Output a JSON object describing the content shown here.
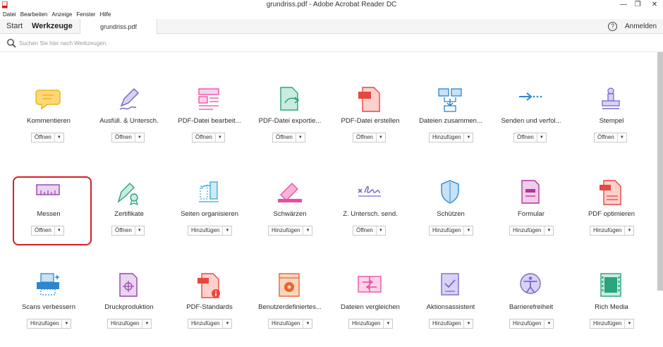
{
  "window": {
    "title": "grundriss.pdf - Adobe Acrobat Reader DC",
    "minimize": "—",
    "maximize": "❐",
    "close": "✕"
  },
  "menu": [
    "Datei",
    "Bearbeiten",
    "Anzeige",
    "Fenster",
    "Hilfe"
  ],
  "tabs": {
    "start": "Start",
    "tools": "Werkzeuge",
    "document": "grundriss.pdf"
  },
  "header": {
    "help": "?",
    "login": "Anmelden"
  },
  "search": {
    "placeholder": "Suchen Sie hier nach Werkzeugen."
  },
  "tools": [
    {
      "label": "Kommentieren",
      "button": "Öffnen",
      "icon": "comment-icon",
      "color": "#f2b21a"
    },
    {
      "label": "Ausfüll. & Untersch.",
      "button": "Öffnen",
      "icon": "fill-sign-icon",
      "color": "#7b68c9"
    },
    {
      "label": "PDF-Datei bearbeit...",
      "button": "Öffnen",
      "icon": "edit-pdf-icon",
      "color": "#e94ba0"
    },
    {
      "label": "PDF-Datei exportie...",
      "button": "Öffnen",
      "icon": "export-pdf-icon",
      "color": "#2aa37f"
    },
    {
      "label": "PDF-Datei erstellen",
      "button": "Öffnen",
      "icon": "create-pdf-icon",
      "color": "#e8473e"
    },
    {
      "label": "Dateien zusammen...",
      "button": "Hinzufügen",
      "icon": "combine-files-icon",
      "color": "#2c87d0"
    },
    {
      "label": "Senden und verfol...",
      "button": "Öffnen",
      "icon": "send-track-icon",
      "color": "#2c87d0"
    },
    {
      "label": "Stempel",
      "button": "Öffnen",
      "icon": "stamp-icon",
      "color": "#7b68c9"
    },
    {
      "label": "Messen",
      "button": "Öffnen",
      "icon": "measure-icon",
      "color": "#9a3fb0"
    },
    {
      "label": "Zertifikate",
      "button": "Öffnen",
      "icon": "certificates-icon",
      "color": "#2aa37f"
    },
    {
      "label": "Seiten organisieren",
      "button": "Hinzufügen",
      "icon": "organize-pages-icon",
      "color": "#3aa6d0"
    },
    {
      "label": "Schwärzen",
      "button": "Hinzufügen",
      "icon": "redact-icon",
      "color": "#e94ba0"
    },
    {
      "label": "Z. Untersch. send.",
      "button": "Öffnen",
      "icon": "send-signature-icon",
      "color": "#7b68c9"
    },
    {
      "label": "Schützen",
      "button": "Hinzufügen",
      "icon": "protect-icon",
      "color": "#2c87d0"
    },
    {
      "label": "Formular",
      "button": "Hinzufügen",
      "icon": "form-icon",
      "color": "#b0369c"
    },
    {
      "label": "PDF optimieren",
      "button": "Hinzufügen",
      "icon": "optimize-pdf-icon",
      "color": "#e8473e"
    },
    {
      "label": "Scans verbessern",
      "button": "Hinzufügen",
      "icon": "enhance-scans-icon",
      "color": "#2c87d0"
    },
    {
      "label": "Druckproduktion",
      "button": "Hinzufügen",
      "icon": "print-production-icon",
      "color": "#9a3fb0"
    },
    {
      "label": "PDF-Standards",
      "button": "Hinzufügen",
      "icon": "pdf-standards-icon",
      "color": "#e8473e"
    },
    {
      "label": "Benutzerdefiniertes...",
      "button": "Hinzufügen",
      "icon": "custom-tool-icon",
      "color": "#e8652a"
    },
    {
      "label": "Dateien vergleichen",
      "button": "Hinzufügen",
      "icon": "compare-files-icon",
      "color": "#e94ba0"
    },
    {
      "label": "Aktionsassistent",
      "button": "Hinzufügen",
      "icon": "action-wizard-icon",
      "color": "#7b68c9"
    },
    {
      "label": "Barrierefreiheit",
      "button": "Hinzufügen",
      "icon": "accessibility-icon",
      "color": "#7b68c9"
    },
    {
      "label": "Rich Media",
      "button": "Hinzufügen",
      "icon": "rich-media-icon",
      "color": "#2aa37f"
    }
  ]
}
